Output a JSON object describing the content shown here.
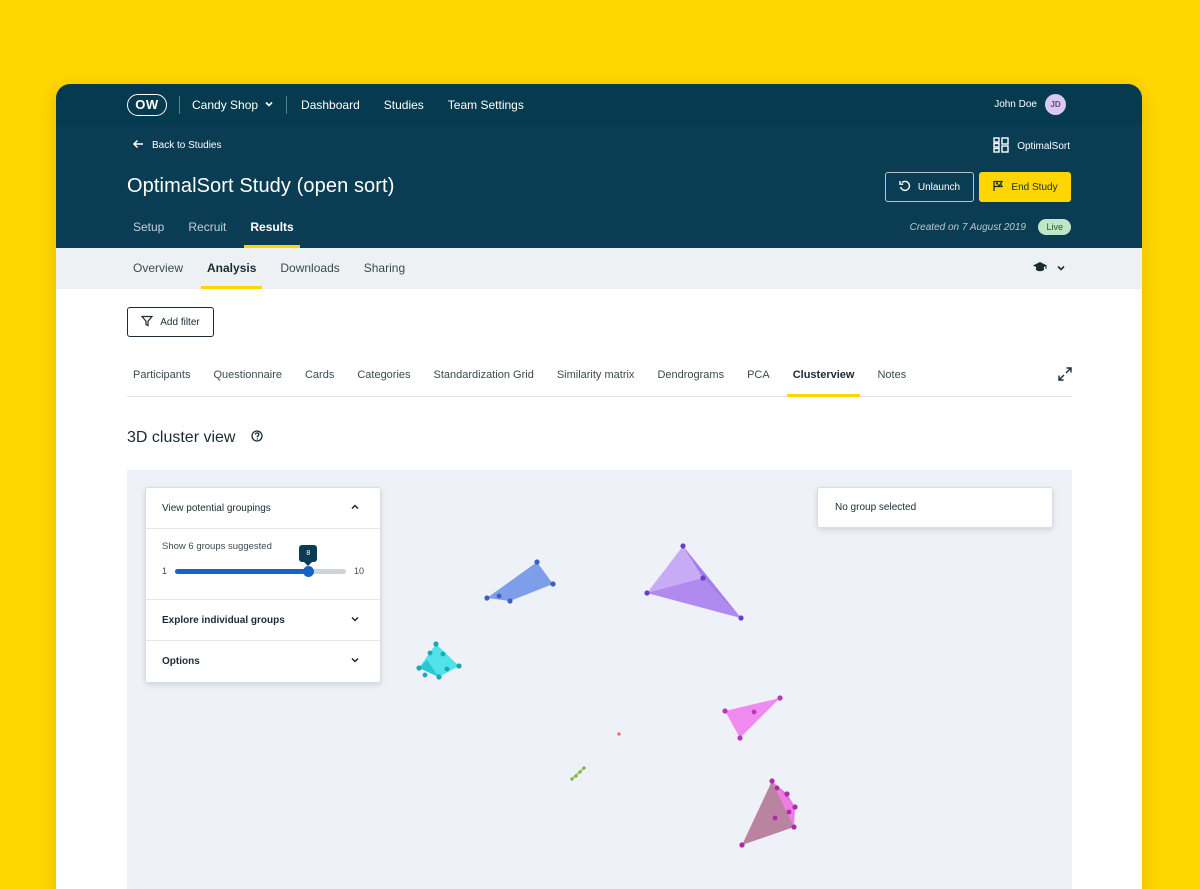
{
  "topnav": {
    "logo": "OW",
    "org": "Candy Shop",
    "links": [
      "Dashboard",
      "Studies",
      "Team Settings"
    ],
    "user_name": "John Doe",
    "user_initials": "JD"
  },
  "header": {
    "back_label": "Back to Studies",
    "product_label": "OptimalSort",
    "study_title": "OptimalSort Study (open sort)",
    "unlaunch_label": "Unlaunch",
    "end_label": "End Study",
    "tabs": [
      "Setup",
      "Recruit",
      "Results"
    ],
    "active_tab": "Results",
    "created": "Created on 7 August 2019",
    "status": "Live"
  },
  "subnav": {
    "tabs": [
      "Overview",
      "Analysis",
      "Downloads",
      "Sharing"
    ],
    "active_tab": "Analysis"
  },
  "analysis": {
    "filter_label": "Add filter",
    "tabs": [
      "Participants",
      "Questionnaire",
      "Cards",
      "Categories",
      "Standardization Grid",
      "Similarity matrix",
      "Dendrograms",
      "PCA",
      "Clusterview",
      "Notes"
    ],
    "active_tab": "Clusterview"
  },
  "cluster_view": {
    "title": "3D cluster view",
    "panel": {
      "groupings_label": "View potential groupings",
      "suggested_label": "Show 6 groups suggested",
      "slider_min": "1",
      "slider_max": "10",
      "slider_value": "8",
      "slider_fraction": 0.78,
      "explore_label": "Explore individual groups",
      "options_label": "Options"
    },
    "selection_label": "No group selected",
    "colors": {
      "blue": "#6b8fe8",
      "lavender": "#b48cf2",
      "cyan": "#40e0e8",
      "pink": "#f07ef0",
      "magenta": "#d65ad6",
      "green": "#a6d46a",
      "red": "#f06060"
    }
  }
}
